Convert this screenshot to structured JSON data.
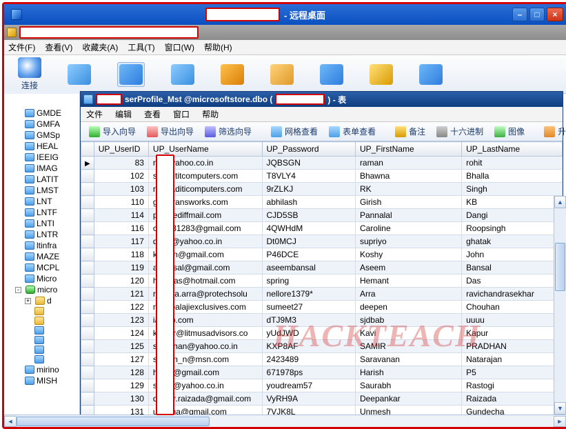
{
  "outer_title_suffix": " - 远程桌面",
  "winbtn_min": "–",
  "winbtn_max": "□",
  "winbtn_close": "×",
  "menubar": [
    "文件(F)",
    "查看(V)",
    "收藏夹(A)",
    "工具(T)",
    "窗口(W)",
    "帮助(H)"
  ],
  "main_toolbar": [
    {
      "label": "连接",
      "icon": "ic-connect"
    },
    {
      "label": "",
      "icon": "ic-grid2"
    },
    {
      "label": "",
      "icon": "ic-grid"
    },
    {
      "label": "",
      "icon": "ic-grid2"
    },
    {
      "label": "",
      "icon": "ic-db"
    },
    {
      "label": "",
      "icon": "ic-export"
    },
    {
      "label": "",
      "icon": "ic-layout"
    },
    {
      "label": "",
      "icon": "ic-doc"
    },
    {
      "label": "",
      "icon": "ic-cal"
    }
  ],
  "left_header": "连接",
  "tree": [
    {
      "label": "GMDE",
      "icon": "tbl",
      "lvl": 2
    },
    {
      "label": "GMFA",
      "icon": "tbl",
      "lvl": 2
    },
    {
      "label": "GMSp",
      "icon": "tbl",
      "lvl": 2
    },
    {
      "label": "HEAL",
      "icon": "tbl",
      "lvl": 2
    },
    {
      "label": "IEEIG",
      "icon": "tbl",
      "lvl": 2
    },
    {
      "label": "IMAG",
      "icon": "tbl",
      "lvl": 2
    },
    {
      "label": "LATIT",
      "icon": "tbl",
      "lvl": 2
    },
    {
      "label": "LMST",
      "icon": "tbl",
      "lvl": 2
    },
    {
      "label": "LNT",
      "icon": "tbl",
      "lvl": 2
    },
    {
      "label": "LNTF",
      "icon": "tbl",
      "lvl": 2
    },
    {
      "label": "LNTI",
      "icon": "tbl",
      "lvl": 2
    },
    {
      "label": "LNTR",
      "icon": "tbl",
      "lvl": 2
    },
    {
      "label": "ltinfra",
      "icon": "tbl",
      "lvl": 2
    },
    {
      "label": "MAZE",
      "icon": "tbl",
      "lvl": 2
    },
    {
      "label": "MCPL",
      "icon": "tbl",
      "lvl": 2
    },
    {
      "label": "Micro",
      "icon": "tbl",
      "lvl": 2
    },
    {
      "label": "micro",
      "icon": "db",
      "lvl": 1,
      "pm": "-"
    },
    {
      "label": "d",
      "icon": "folder",
      "lvl": 2,
      "pm": "+"
    },
    {
      "label": "",
      "icon": "folder",
      "lvl": 3
    },
    {
      "label": "",
      "icon": "folder",
      "lvl": 3
    },
    {
      "label": "",
      "icon": "tbl",
      "lvl": 3
    },
    {
      "label": "",
      "icon": "tbl",
      "lvl": 3
    },
    {
      "label": "",
      "icon": "tbl",
      "lvl": 3
    },
    {
      "label": "",
      "icon": "tbl",
      "lvl": 3
    },
    {
      "label": "mirino",
      "icon": "tbl",
      "lvl": 2
    },
    {
      "label": "MISH",
      "icon": "tbl",
      "lvl": 2
    }
  ],
  "doc_title_parts": {
    "mid": "serProfile_Mst @microsoftstore.dbo (",
    "end": ") - 表"
  },
  "doc_menu": [
    "文件",
    "编辑",
    "查看",
    "窗口",
    "帮助"
  ],
  "doc_tools": [
    {
      "icon": "imp",
      "label": "导入向导"
    },
    {
      "icon": "exp",
      "label": "导出向导"
    },
    {
      "icon": "filter",
      "label": "筛选向导"
    },
    {
      "icon": "gridv",
      "label": "网格查看"
    },
    {
      "icon": "formv",
      "label": "表单查看"
    },
    {
      "icon": "note",
      "label": "备注"
    },
    {
      "icon": "hex",
      "label": "十六进制"
    },
    {
      "icon": "img",
      "label": "图像"
    },
    {
      "icon": "sort",
      "label": "升序排序"
    }
  ],
  "columns": [
    "UP_UserID",
    "UP_UserName",
    "UP_Password",
    "UP_FirstName",
    "UP_LastName"
  ],
  "rows": [
    {
      "id": 83,
      "un": "ro      @yahoo.co.in",
      "pw": "JQBSGN",
      "fn": "raman",
      "ln": "rohit"
    },
    {
      "id": 102,
      "un": "sa      adititcomputers.com",
      "pw": "T8VLY4",
      "fn": "Bhawna",
      "ln": "Bhalla"
    },
    {
      "id": 103,
      "un": "rk      @aditicomputers.com",
      "pw": "9rZLKJ",
      "fn": "RK",
      "ln": "Singh"
    },
    {
      "id": 110,
      "un": "gi      @transworks.com",
      "pw": "abhilash",
      "fn": "Girish",
      "ln": "KB"
    },
    {
      "id": 114,
      "un": "pl      @rediffmail.com",
      "pw": "CJD5SB",
      "fn": "Pannalal",
      "ln": "Dangi"
    },
    {
      "id": 116,
      "un": "cl      vid31283@gmail.com",
      "pw": "4QWHdM",
      "fn": "Caroline",
      "ln": "Roopsingh"
    },
    {
      "id": 117,
      "un": "dr      yo@yahoo.co.in",
      "pw": "Dt0MCJ",
      "fn": "supriyo",
      "ln": "ghatak"
    },
    {
      "id": 118,
      "un": "ko      phn@gmail.com",
      "pw": "P46DCE",
      "fn": "Koshy",
      "ln": "John"
    },
    {
      "id": 119,
      "un": "as      ansal@gmail.com",
      "pw": "aseembansal",
      "fn": "Aseem",
      "ln": "Bansal"
    },
    {
      "id": 120,
      "un": "he      _das@hotmail.com",
      "pw": "spring",
      "fn": "Hemant",
      "ln": "Das"
    },
    {
      "id": 121,
      "un": "ra      ndra.arra@protechsolu",
      "pw": "nellore1379*",
      "fn": "Arra",
      "ln": "ravichandrasekhar"
    },
    {
      "id": 122,
      "un": "m       @balajiexclusives.com",
      "pw": "sumeet27",
      "fn": "deepen",
      "ln": "Chouhan"
    },
    {
      "id": 123,
      "un": "ia      hoo.com",
      "pw": "dTJ9M3",
      "fn": "sjdbab",
      "ln": "uuuu"
    },
    {
      "id": 124,
      "un": "ka      our@litmusadvisors.co",
      "pw": "yUdJWD",
      "fn": "Kavi",
      "ln": "Kapur"
    },
    {
      "id": 125,
      "un": "sn      adhan@yahoo.co.in",
      "pw": "KXP8AF",
      "fn": "SAMIR",
      "ln": "PRADHAN"
    },
    {
      "id": 127,
      "un": "sa      han_n@msn.com",
      "pw": "2423489",
      "fn": "Saravanan",
      "ln": "Natarajan"
    },
    {
      "id": 128,
      "un": "ha      sh@gmail.com",
      "pw": "671978ps",
      "fn": "Harish",
      "ln": "P5"
    },
    {
      "id": 129,
      "un": "sn      74@yahoo.co.in",
      "pw": "youdream57",
      "fn": "Saurabh",
      "ln": "Rastogi"
    },
    {
      "id": 130,
      "un": "de      kar.raizada@gmail.com",
      "pw": "VyRH9A",
      "fn": "Deepankar",
      "ln": "Raizada"
    },
    {
      "id": 131,
      "un": "ur      echa@gmail.com",
      "pw": "7VJK8L",
      "fn": "Unmesh",
      "ln": "Gundecha"
    }
  ],
  "watermark": "HACKTEACH"
}
